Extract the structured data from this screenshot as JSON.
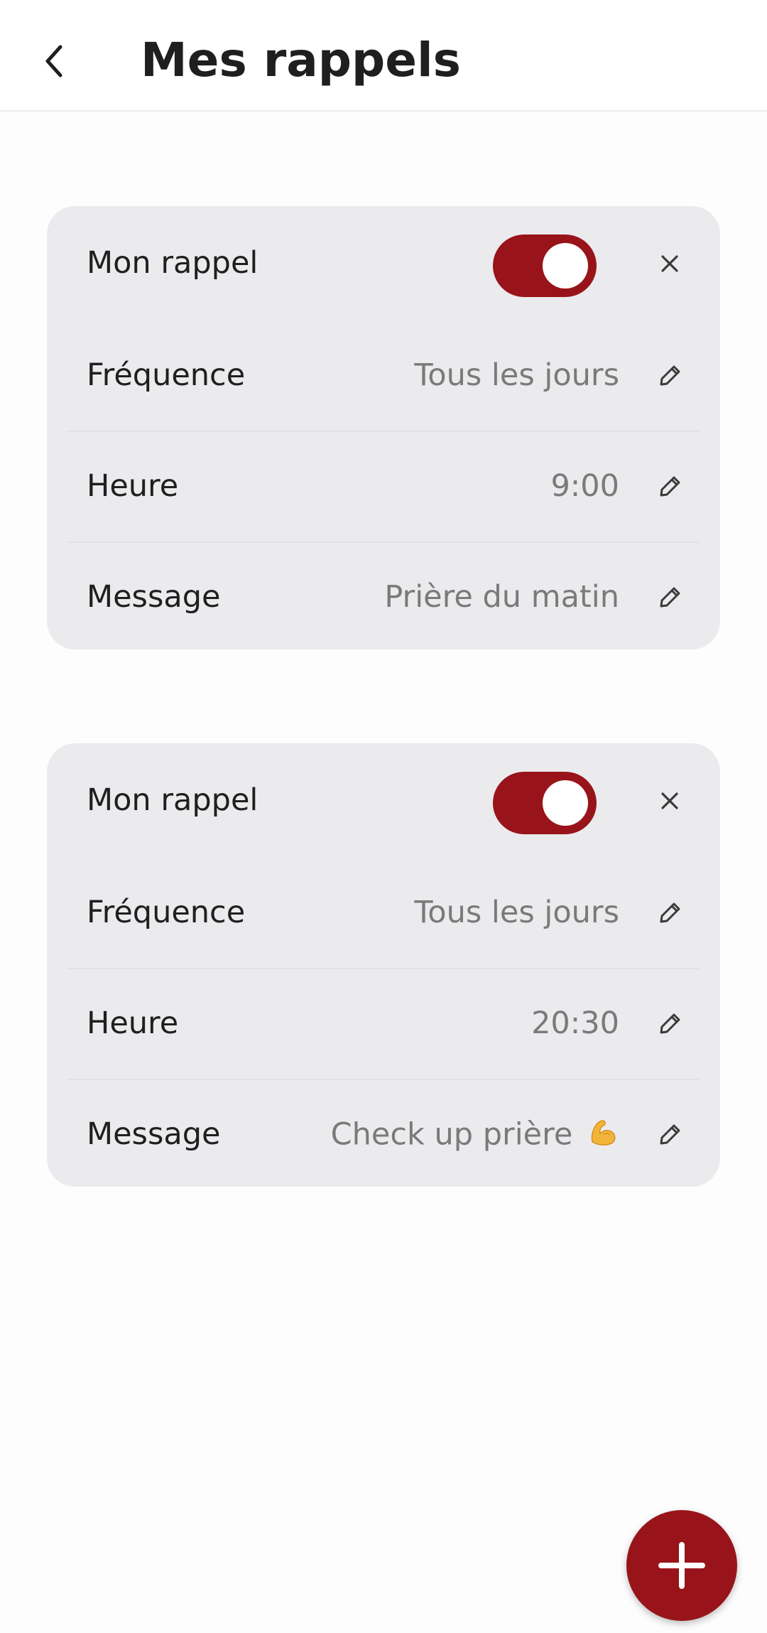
{
  "header": {
    "title": "Mes rappels",
    "back_icon": "chevron-left-icon"
  },
  "colors": {
    "accent": "#98141a",
    "card_background": "#ebebee",
    "value_text": "#7a7a7a"
  },
  "reminders": [
    {
      "title": "Mon rappel",
      "enabled": true,
      "frequency_label": "Fréquence",
      "frequency_value": "Tous les jours",
      "time_label": "Heure",
      "time_value": "9:00",
      "message_label": "Message",
      "message_value": "Prière du matin"
    },
    {
      "title": "Mon rappel",
      "enabled": true,
      "frequency_label": "Fréquence",
      "frequency_value": "Tous les jours",
      "time_label": "Heure",
      "time_value": "20:30",
      "message_label": "Message",
      "message_value": "Check up prière",
      "message_emoji": "flexed-biceps-emoji"
    }
  ],
  "fab": {
    "icon": "plus-icon"
  }
}
